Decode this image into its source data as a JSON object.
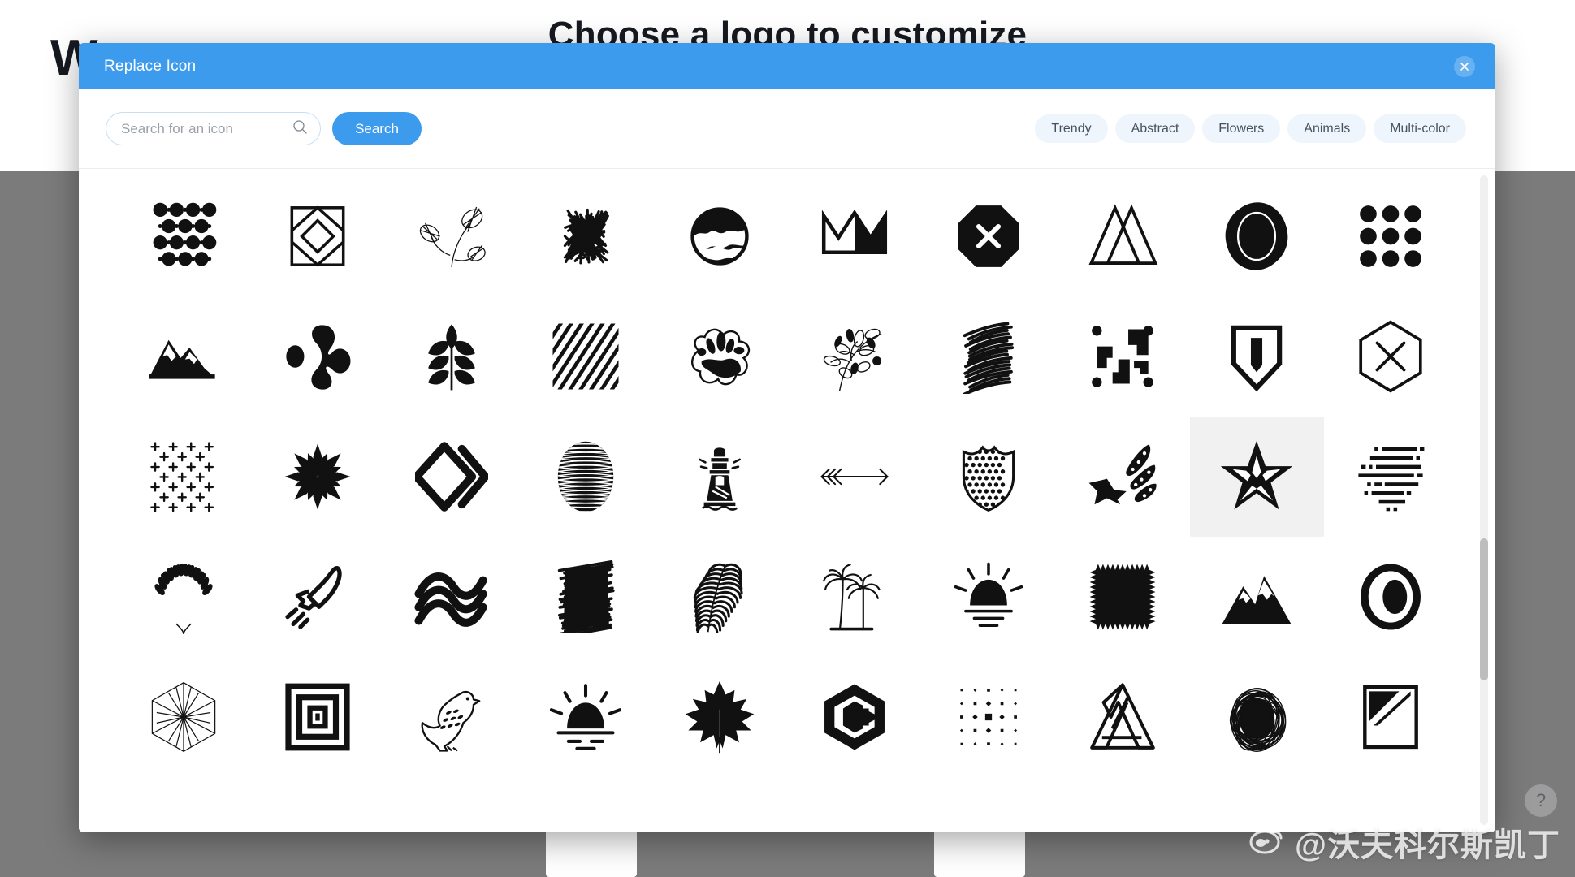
{
  "background": {
    "heading": "Choose a logo to customize",
    "logo_word": "W"
  },
  "modal": {
    "title": "Replace Icon",
    "close_icon": "close-icon"
  },
  "toolbar": {
    "search": {
      "placeholder": "Search for an icon",
      "value": "",
      "icon": "search-icon"
    },
    "search_button_label": "Search",
    "categories": [
      {
        "label": "Trendy"
      },
      {
        "label": "Abstract"
      },
      {
        "label": "Flowers"
      },
      {
        "label": "Animals"
      },
      {
        "label": "Multi-color"
      }
    ]
  },
  "colors": {
    "accent": "#3d9bee",
    "chip_bg": "#eef5fc",
    "selected_cell_bg": "#f1f1f1",
    "backdrop": "#7b7b7b",
    "icon_black": "#111111"
  },
  "icon_grid": {
    "columns": 10,
    "rows": 5,
    "selected_index": 28,
    "icons": [
      {
        "name": "halftone-dots-pattern-icon"
      },
      {
        "name": "nested-geometric-square-icon"
      },
      {
        "name": "fern-sprig-line-icon"
      },
      {
        "name": "scribble-cluster-icon"
      },
      {
        "name": "globe-circle-icon"
      },
      {
        "name": "crown-icon"
      },
      {
        "name": "octagon-x-icon"
      },
      {
        "name": "double-triangle-peaks-icon"
      },
      {
        "name": "scribble-oval-seal-icon"
      },
      {
        "name": "nine-dot-grid-icon"
      },
      {
        "name": "mountain-range-icon"
      },
      {
        "name": "molecule-blob-icon"
      },
      {
        "name": "compound-leaf-icon"
      },
      {
        "name": "diagonal-stripes-square-icon"
      },
      {
        "name": "ink-splat-icon"
      },
      {
        "name": "botanical-branch-icon"
      },
      {
        "name": "scribble-hatch-blob-icon"
      },
      {
        "name": "abstract-arrows-square-icon"
      },
      {
        "name": "shield-outline-icon"
      },
      {
        "name": "hexagon-x-icon"
      },
      {
        "name": "plus-grid-pattern-icon"
      },
      {
        "name": "starburst-flower-icon"
      },
      {
        "name": "diamond-chevron-icon"
      },
      {
        "name": "striped-sphere-icon"
      },
      {
        "name": "lighthouse-icon"
      },
      {
        "name": "long-arrow-right-icon"
      },
      {
        "name": "dotted-shield-icon"
      },
      {
        "name": "shooting-star-icon"
      },
      {
        "name": "nautical-star-icon"
      },
      {
        "name": "speed-lines-icon"
      },
      {
        "name": "laurel-wreath-icon"
      },
      {
        "name": "rocket-icon"
      },
      {
        "name": "waves-stripes-icon"
      },
      {
        "name": "scribble-block-icon"
      },
      {
        "name": "palm-frond-icon"
      },
      {
        "name": "palm-trees-icon"
      },
      {
        "name": "sunrise-rays-icon"
      },
      {
        "name": "zigzag-edge-square-icon"
      },
      {
        "name": "snow-mountains-icon"
      },
      {
        "name": "circle-oval-ring-icon"
      },
      {
        "name": "hexagon-wireframe-icon"
      },
      {
        "name": "nested-squares-maze-icon"
      },
      {
        "name": "eagle-bird-icon"
      },
      {
        "name": "sunset-horizon-icon"
      },
      {
        "name": "maple-leaf-icon"
      },
      {
        "name": "letter-c-hexagon-icon"
      },
      {
        "name": "diamond-dot-grid-icon"
      },
      {
        "name": "penrose-triangle-icon"
      },
      {
        "name": "scribble-circle-icon"
      },
      {
        "name": "square-diagonal-split-icon"
      }
    ]
  },
  "watermark": {
    "text": "@沃夫科尔斯凯丁",
    "logo": "weibo-logo-icon"
  },
  "help": {
    "label": "?"
  }
}
